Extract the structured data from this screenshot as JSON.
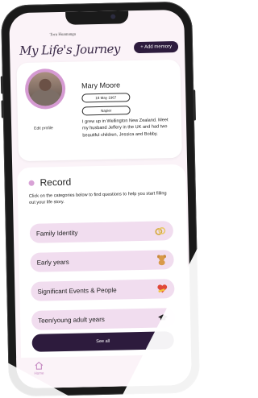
{
  "header": {
    "logo_sub": "Toru Huamanga",
    "logo_main": "My Life's Journey",
    "add_memory": "+ Add memory"
  },
  "profile": {
    "name": "Mary Moore",
    "dob": "18 May 1967",
    "place": "Napier",
    "edit": "Edit profile",
    "bio": "I grew up in Wellington New Zealand. Meet my husband Jeffery in the UK and had two beautiful children, Jessica and Bobby."
  },
  "record": {
    "title": "Record",
    "description": "Click on the categories below to find questions to help you start filling out your life story.",
    "categories": [
      {
        "label": "Family Identity",
        "icon": "rings-icon"
      },
      {
        "label": "Early years",
        "icon": "teddy-bear-icon"
      },
      {
        "label": "Significant Events & People",
        "icon": "heart-icon"
      },
      {
        "label": "Teen/young adult years",
        "icon": "cap-icon"
      }
    ],
    "see_all": "See all"
  },
  "nav": {
    "home": "Home"
  },
  "colors": {
    "primary_dark": "#2d1b3d",
    "accent_pink": "#d8a2d6",
    "category_bg": "#f1ddef",
    "screen_bg": "#fbf3f8"
  }
}
